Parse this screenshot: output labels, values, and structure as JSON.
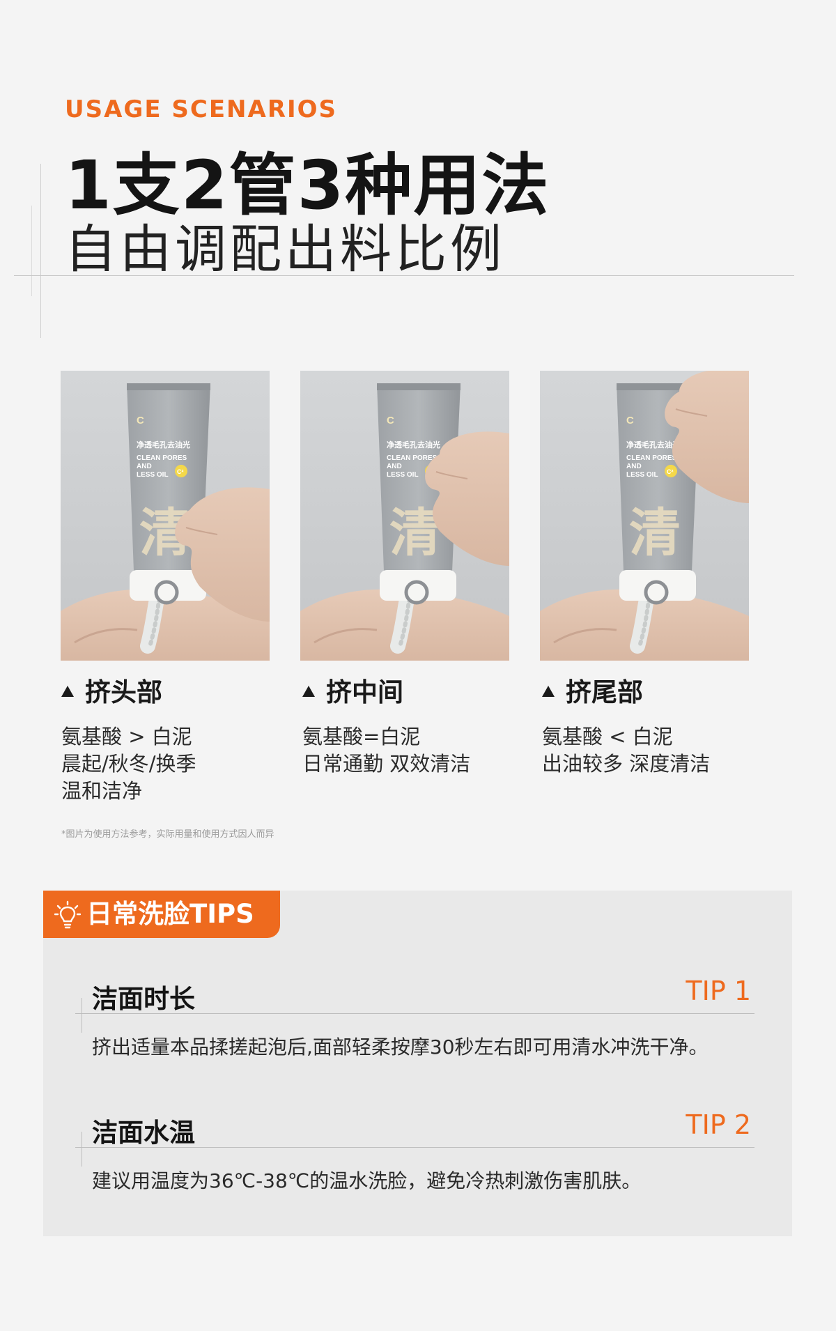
{
  "header": {
    "kicker": "USAGE SCENARIOS",
    "title": "1支2管3种用法",
    "subtitle": "自由调配出料比例"
  },
  "columns": [
    {
      "title": "挤头部",
      "lines": [
        "氨基酸 > 白泥",
        "晨起/秋冬/换季",
        "温和洁净"
      ]
    },
    {
      "title": "挤中间",
      "lines": [
        "氨基酸=白泥",
        "日常通勤 双效清洁"
      ]
    },
    {
      "title": "挤尾部",
      "lines": [
        "氨基酸 < 白泥",
        "出油较多 深度清洁"
      ]
    }
  ],
  "product": {
    "brand": "C",
    "tube_cn": "净透毛孔去油光",
    "tube_en": [
      "CLEAN PORES",
      "AND",
      "LESS OIL"
    ],
    "badge": "C²",
    "big_char": "清"
  },
  "note": "*图片为使用方法参考，实际用量和使用方式因人而异",
  "tips": {
    "tab_label": "日常洗脸TIPS",
    "items": [
      {
        "heading": "洁面时长",
        "num": "TIP 1",
        "body": "挤出适量本品揉搓起泡后,面部轻柔按摩30秒左右即可用清水冲洗干净。"
      },
      {
        "heading": "洁面水温",
        "num": "TIP 2",
        "body": "建议用温度为36℃-38℃的温水洗脸，避免冷热刺激伤害肌肤。"
      }
    ]
  },
  "colors": {
    "accent": "#ee6a1e",
    "text": "#1c1c1c",
    "background": "#f4f4f4",
    "panel": "#e9e9e9"
  },
  "icons": [
    "lightbulb-icon",
    "triangle-up-icon"
  ]
}
